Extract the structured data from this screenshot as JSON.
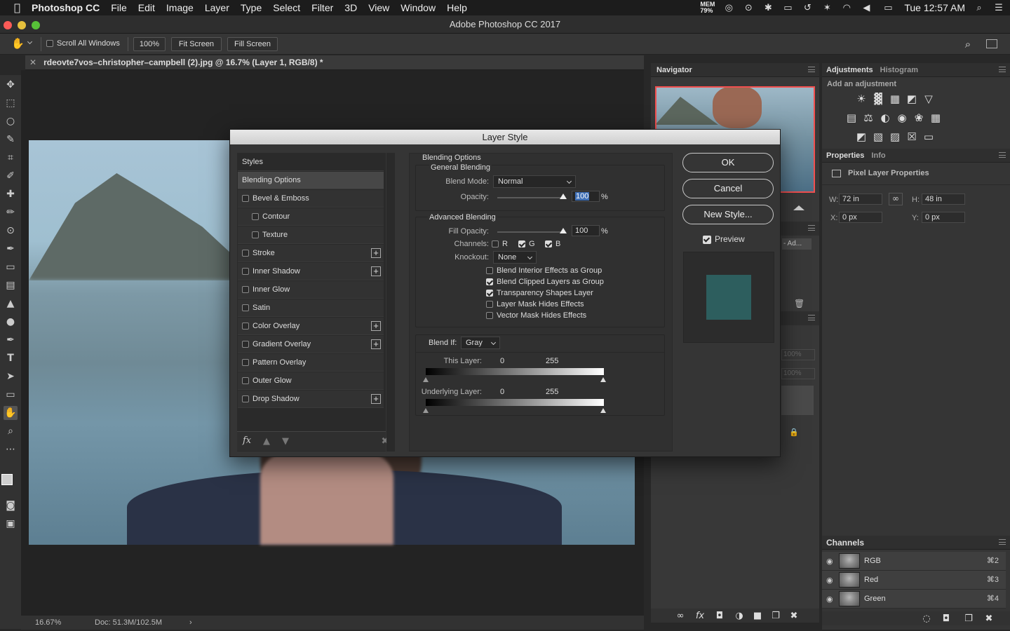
{
  "menubar": {
    "app": "Photoshop CC",
    "items": [
      "File",
      "Edit",
      "Image",
      "Layer",
      "Type",
      "Select",
      "Filter",
      "3D",
      "View",
      "Window",
      "Help"
    ],
    "mem": "MEM\n79%",
    "clock": "Tue 12:57 AM"
  },
  "window": {
    "title": "Adobe Photoshop CC 2017"
  },
  "options": {
    "scroll_all": "Scroll All Windows",
    "zoom": "100%",
    "fit": "Fit Screen",
    "fill": "Fill Screen"
  },
  "doc": {
    "tab": "rdeovte7vos–christopher–campbell (2).jpg @ 16.7% (Layer 1, RGB/8) *",
    "zoom": "16.67%",
    "docsize": "Doc: 51.3M/102.5M"
  },
  "dialog": {
    "title": "Layer Style",
    "styles_header": "Styles",
    "styles": [
      {
        "label": "Blending Options",
        "checkbox": false,
        "selected": true,
        "plus": false,
        "indent": false
      },
      {
        "label": "Bevel & Emboss",
        "checkbox": true,
        "plus": false,
        "indent": false
      },
      {
        "label": "Contour",
        "checkbox": true,
        "plus": false,
        "indent": true
      },
      {
        "label": "Texture",
        "checkbox": true,
        "plus": false,
        "indent": true
      },
      {
        "label": "Stroke",
        "checkbox": true,
        "plus": true,
        "indent": false
      },
      {
        "label": "Inner Shadow",
        "checkbox": true,
        "plus": true,
        "indent": false
      },
      {
        "label": "Inner Glow",
        "checkbox": true,
        "plus": false,
        "indent": false
      },
      {
        "label": "Satin",
        "checkbox": true,
        "plus": false,
        "indent": false
      },
      {
        "label": "Color Overlay",
        "checkbox": true,
        "plus": true,
        "indent": false
      },
      {
        "label": "Gradient Overlay",
        "checkbox": true,
        "plus": true,
        "indent": false
      },
      {
        "label": "Pattern Overlay",
        "checkbox": true,
        "plus": false,
        "indent": false
      },
      {
        "label": "Outer Glow",
        "checkbox": true,
        "plus": false,
        "indent": false
      },
      {
        "label": "Drop Shadow",
        "checkbox": true,
        "plus": true,
        "indent": false
      }
    ],
    "blending_title": "Blending Options",
    "general_title": "General Blending",
    "blend_mode_label": "Blend Mode:",
    "blend_mode": "Normal",
    "opacity_label": "Opacity:",
    "opacity": "100",
    "pct": "%",
    "advanced_title": "Advanced Blending",
    "fill_opacity_label": "Fill Opacity:",
    "fill_opacity": "100",
    "channels_label": "Channels:",
    "ch_r": "R",
    "ch_g": "G",
    "ch_b": "B",
    "ch_values": {
      "r": false,
      "g": true,
      "b": true
    },
    "knockout_label": "Knockout:",
    "knockout": "None",
    "adv_options": [
      {
        "label": "Blend Interior Effects as Group",
        "checked": false
      },
      {
        "label": "Blend Clipped Layers as Group",
        "checked": true
      },
      {
        "label": "Transparency Shapes Layer",
        "checked": true
      },
      {
        "label": "Layer Mask Hides Effects",
        "checked": false
      },
      {
        "label": "Vector Mask Hides Effects",
        "checked": false
      }
    ],
    "blend_if_label": "Blend If:",
    "blend_if": "Gray",
    "this_layer_label": "This Layer:",
    "underlying_label": "Underlying Layer:",
    "range_low": "0",
    "range_high": "255",
    "ok": "OK",
    "cancel": "Cancel",
    "new_style": "New Style...",
    "preview": "Preview",
    "preview_color": "#2d5e5e",
    "fx": "fx"
  },
  "navigator": {
    "title": "Navigator"
  },
  "adjustments": {
    "tab1": "Adjustments",
    "tab2": "Histogram",
    "add": "Add an adjustment"
  },
  "properties": {
    "tab1": "Properties",
    "tab2": "Info",
    "subtitle": "Pixel Layer Properties",
    "w_label": "W:",
    "w": "72 in",
    "h_label": "H:",
    "h": "48 in",
    "x_label": "X:",
    "x": "0 px",
    "y_label": "Y:",
    "y": "0 px"
  },
  "layers": {
    "opacity": "100%",
    "fill": "100%",
    "adj": "- Ad..."
  },
  "channels": {
    "title": "Channels",
    "rows": [
      {
        "name": "RGB",
        "key": "⌘2"
      },
      {
        "name": "Red",
        "key": "⌘3"
      },
      {
        "name": "Green",
        "key": "⌘4"
      }
    ]
  }
}
